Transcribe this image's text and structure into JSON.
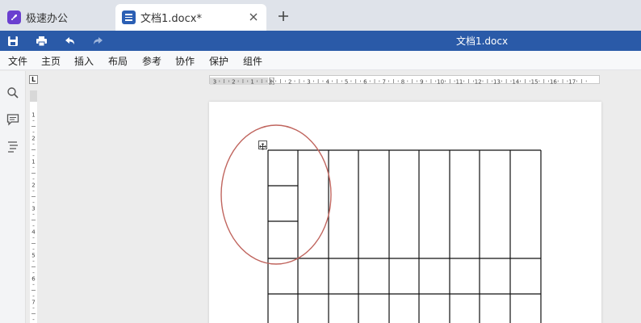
{
  "tabs": [
    {
      "label": "极速办公",
      "active": false
    },
    {
      "label": "文档1.docx*",
      "active": true
    }
  ],
  "quickbar": {
    "title": "文档1.docx",
    "color": "#2a5aa8"
  },
  "menu": [
    "文件",
    "主页",
    "插入",
    "布局",
    "参考",
    "协作",
    "保护",
    "组件"
  ],
  "sidebar_icons": [
    "search-icon",
    "comment-icon",
    "navigation-icon"
  ],
  "ruler_corner": "L",
  "hruler_labels": [
    "3",
    "2",
    "1",
    "1",
    "2",
    "3",
    "4",
    "5",
    "6",
    "7",
    "8",
    "9",
    "10",
    "11",
    "12",
    "13",
    "14",
    "15",
    "16",
    "17"
  ],
  "vruler_labels": [
    "1",
    "2",
    "1",
    "2",
    "3",
    "4",
    "5",
    "6",
    "7",
    "8"
  ],
  "table": {
    "columns": 9,
    "top_rows_merged_after_col1": true,
    "first_col_sub_rows": 3,
    "lower_rows": 2
  },
  "annotation_color": "#c0655e"
}
